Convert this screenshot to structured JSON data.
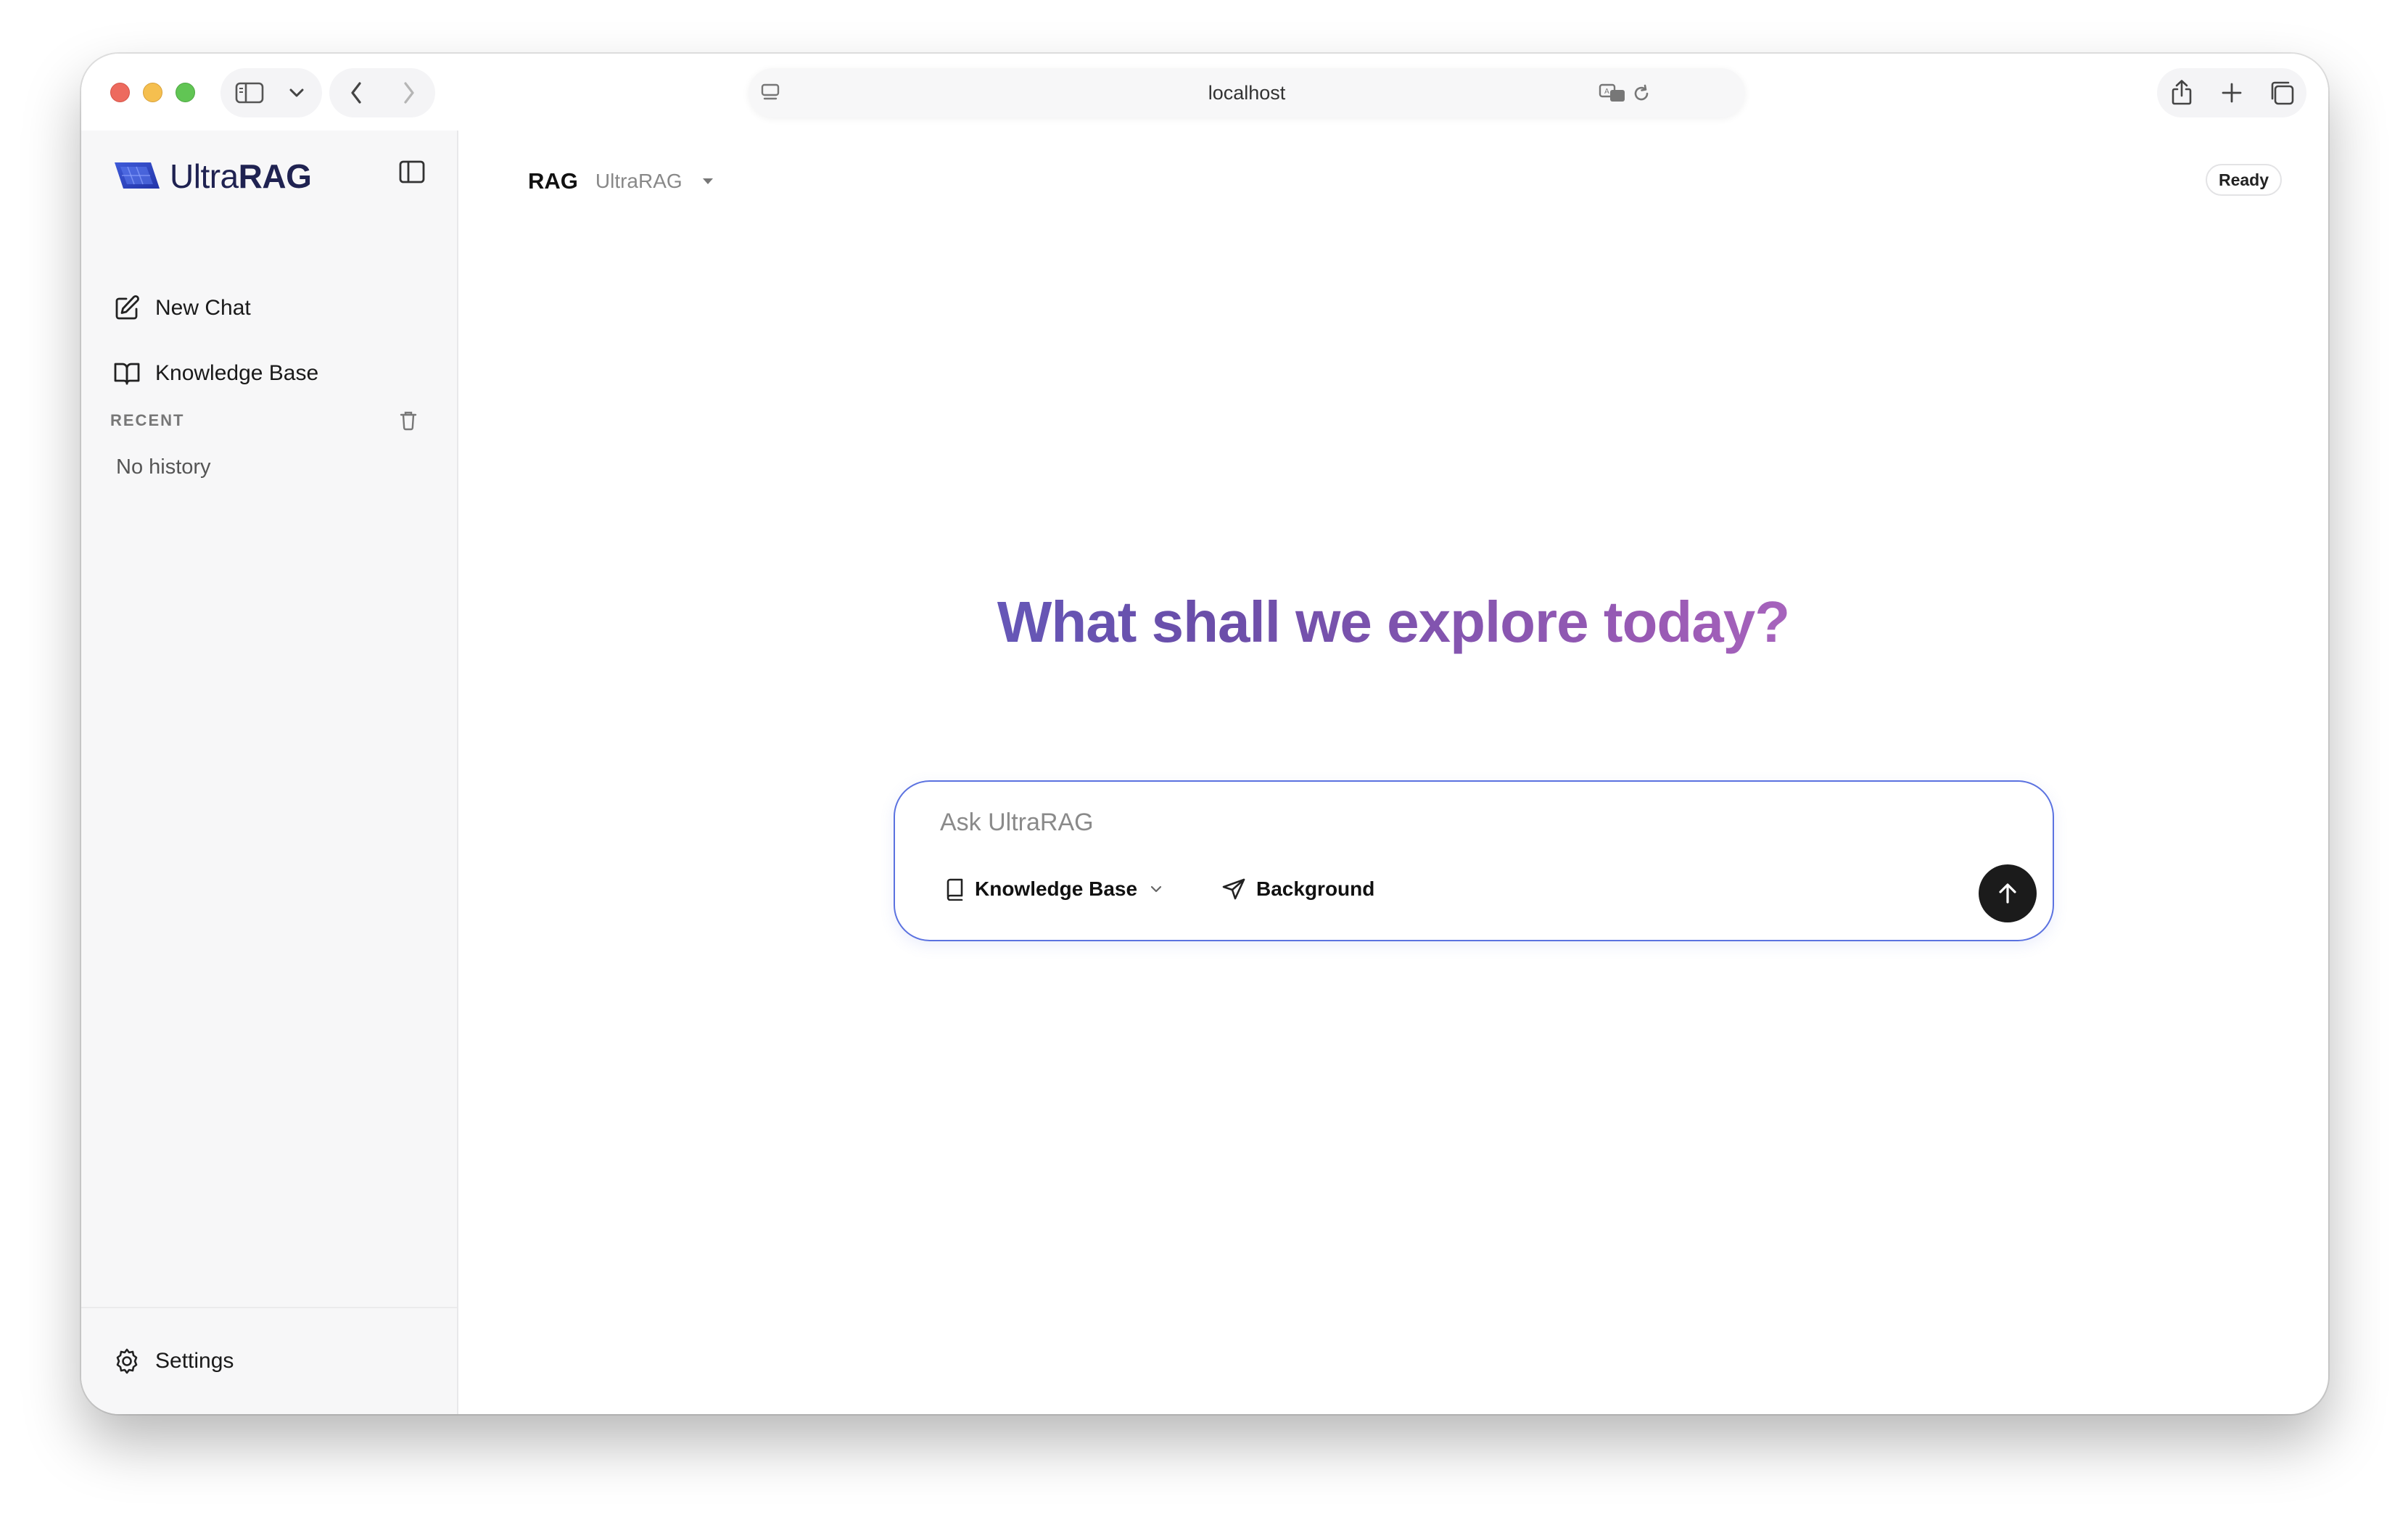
{
  "browser": {
    "url": "localhost",
    "icons": {
      "sidebar_toggle": "sidebar-icon",
      "back": "chevron-left-icon",
      "forward": "chevron-right-icon",
      "translate": "translate-icon",
      "reload": "reload-icon",
      "share": "share-icon",
      "new_tab": "plus-icon",
      "tab_overview": "tabs-icon"
    }
  },
  "sidebar": {
    "logo": {
      "prefix": "Ultra",
      "suffix": "RAG"
    },
    "nav": [
      {
        "label": "New Chat",
        "icon": "edit-icon"
      },
      {
        "label": "Knowledge Base",
        "icon": "book-icon"
      }
    ],
    "recent_label": "RECENT",
    "empty_history": "No history",
    "settings_label": "Settings"
  },
  "header": {
    "mode": "RAG",
    "pipeline": "UltraRAG",
    "status": "Ready"
  },
  "main": {
    "headline": "What shall we explore today?",
    "input_placeholder": "Ask UltraRAG",
    "input_value": "",
    "knowledge_base_label": "Knowledge Base",
    "background_label": "Background"
  },
  "colors": {
    "accent_border": "#5b72e0",
    "gradient_start": "#5b6fdc",
    "gradient_end": "#dc8ce0",
    "send_button": "#1b1b1b"
  }
}
